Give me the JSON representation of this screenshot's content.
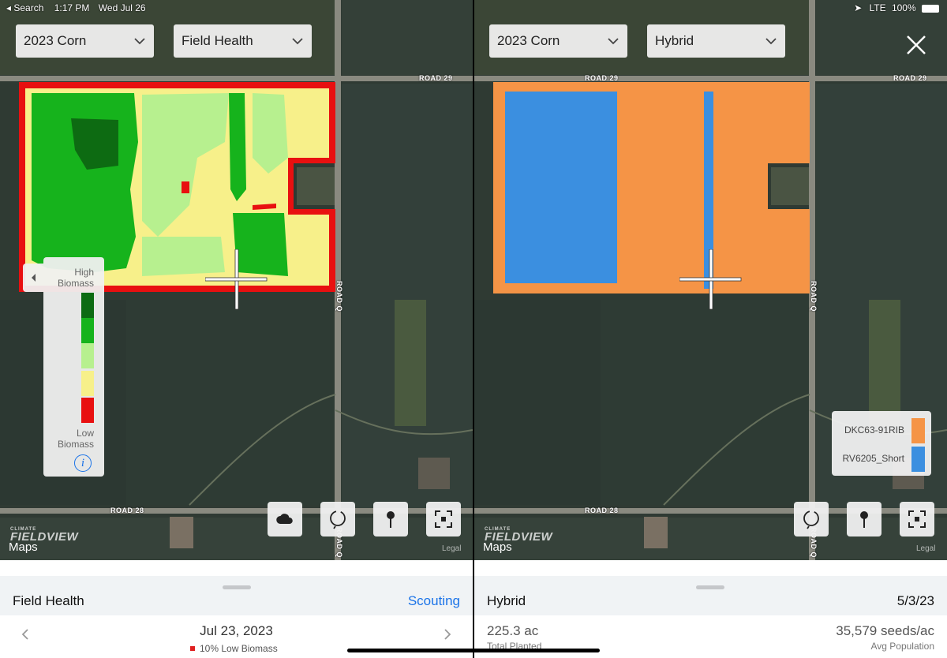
{
  "status_bar": {
    "back_label": "◂ Search",
    "time": "1:17 PM",
    "date": "Wed Jul 26",
    "network": "LTE",
    "battery": "100%"
  },
  "left": {
    "season_select": "2023 Corn",
    "layer_select": "Field Health",
    "legend": {
      "high_label": "High Biomass",
      "low_label": "Low Biomass",
      "colors": [
        "#0d6b12",
        "#16b31c",
        "#b7f08f",
        "#f7f08a",
        "#e81010"
      ]
    },
    "tools": [
      "cloud-icon",
      "lasso-icon",
      "pin-icon",
      "fullscreen-icon"
    ],
    "sheet": {
      "title": "Field Health",
      "action": "Scouting",
      "date": "Jul 23, 2023",
      "subtitle": "10% Low Biomass"
    }
  },
  "right": {
    "season_select": "2023 Corn",
    "layer_select": "Hybrid",
    "legend": [
      {
        "name": "DKC63-91RIB",
        "color": "#f59446"
      },
      {
        "name": "RV6205_Short",
        "color": "#3b8fe0"
      }
    ],
    "tools": [
      "lasso-icon",
      "pin-icon",
      "fullscreen-icon"
    ],
    "sheet": {
      "title": "Hybrid",
      "date": "5/3/23",
      "planted_value": "225.3 ac",
      "planted_caption": "Total Planted",
      "population_value": "35,579 seeds/ac",
      "population_caption": "Avg Population"
    }
  },
  "map": {
    "road_north": "ROAD 29",
    "road_south": "ROAD 28",
    "road_east": "ROAD Q",
    "brand_small": "CLIMATE",
    "brand_big": "FIELDVIEW",
    "maps_label": "Maps",
    "legal_label": "Legal"
  }
}
